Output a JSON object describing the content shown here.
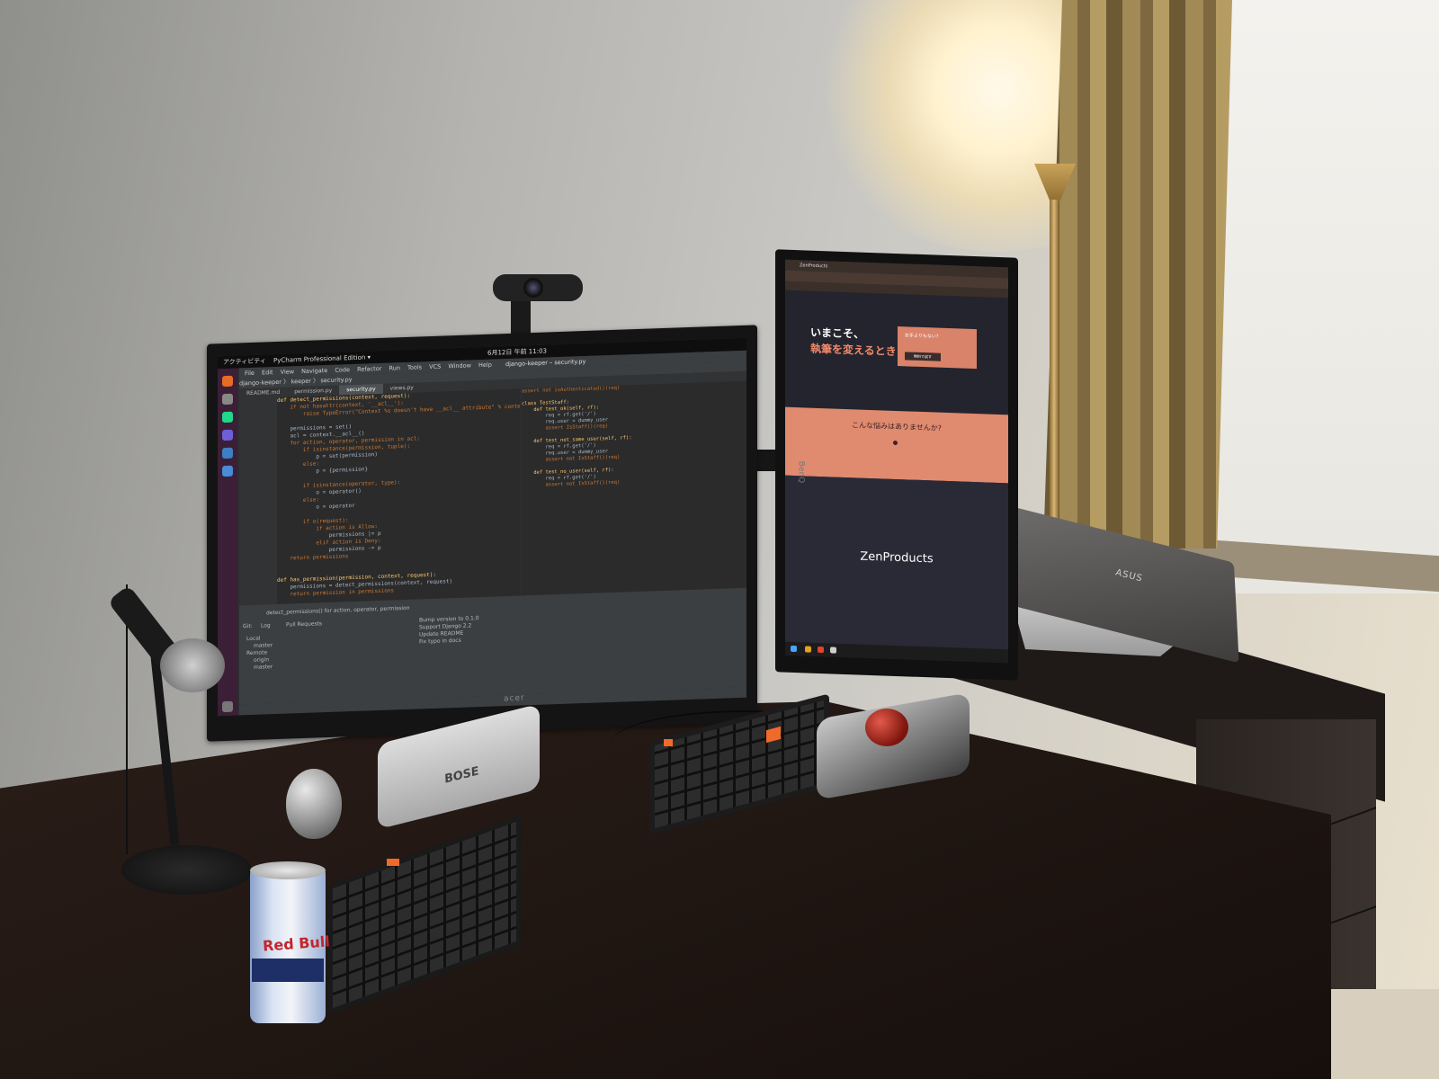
{
  "left_monitor": {
    "brand": "acer",
    "top_bar": {
      "activities": "アクティビティ",
      "app": "PyCharm Professional Edition ▾",
      "clock": "6月12日 午前 11:03",
      "window_title": "django-keeper – security.py"
    },
    "menu": [
      "File",
      "Edit",
      "View",
      "Navigate",
      "Code",
      "Refactor",
      "Run",
      "Tools",
      "VCS",
      "Window",
      "Help"
    ],
    "breadcrumb": "django-keeper 〉 keeper 〉 security.py",
    "tabs": [
      "README.md",
      "permission.py",
      "security.py",
      "views.py"
    ],
    "active_tab": "security.py",
    "code_left": [
      "def detect_permissions(context, request):",
      "    if not hasattr(context, '__acl__'):",
      "        raise TypeError(\"Context %s doesn't have __acl__ attribute\" % context)",
      "",
      "    permissions = set()",
      "    acl = context.__acl__()",
      "    for action, operator, permission in acl:",
      "        if isinstance(permission, tuple):",
      "            p = set(permission)",
      "        else:",
      "            p = {permission}",
      "",
      "        if isinstance(operator, type):",
      "            o = operator()",
      "        else:",
      "            o = operator",
      "",
      "        if o(request):",
      "            if action is Allow:",
      "                permissions |= p",
      "            elif action is Deny:",
      "                permissions -= p",
      "    return permissions",
      "",
      "",
      "def has_permission(permission, context, request):",
      "    permissions = detect_permissions(context, request)",
      "    return permission in permissions"
    ],
    "code_right": [
      "assert not isAuthenticated()(req)",
      "",
      "class TestStaff:",
      "    def test_ok(self, rf):",
      "        req = rf.get('/')",
      "        req.user = dummy_user",
      "        assert IsStaff()(req)",
      "",
      "    def test_not_same_user(self, rf):",
      "        req = rf.get('/')",
      "        req.user = dummy_user",
      "        assert not IsStaff()(req)",
      "",
      "    def test_no_user(self, rf):",
      "        req = rf.get('/')",
      "        assert not IsStaff()(req)"
    ],
    "bottom_panel": {
      "status_line": "detect_permissions()   for action, operator, permission",
      "git_tabs": [
        "Git:",
        "Log",
        "Pull Requests"
      ],
      "branches": [
        "Local",
        "master",
        "Remote",
        "origin",
        "master"
      ],
      "commits": [
        "Bump version to 0.1.0",
        "Support Django 2.2",
        "Update README",
        "Fix typo in docs"
      ]
    }
  },
  "right_monitor": {
    "brand": "BenQ",
    "browser_tab": "ZenProducts",
    "hero": {
      "line1": "いまこそ、",
      "line2": "執筆を変えるとき",
      "card_title": "お手よりもない?",
      "card_button": "無料で試す"
    },
    "band": {
      "title": "こんな悩みはありませんか?"
    },
    "brand_title": "ZenProducts"
  },
  "desk_items": {
    "speaker_brand": "BOSE",
    "can_brand": "Red Bull",
    "laptop_brand": "ASUS"
  },
  "colors": {
    "accent_orange": "#f06a2a",
    "web_coral": "#e08a70",
    "ide_bg": "#2b2b2b"
  }
}
